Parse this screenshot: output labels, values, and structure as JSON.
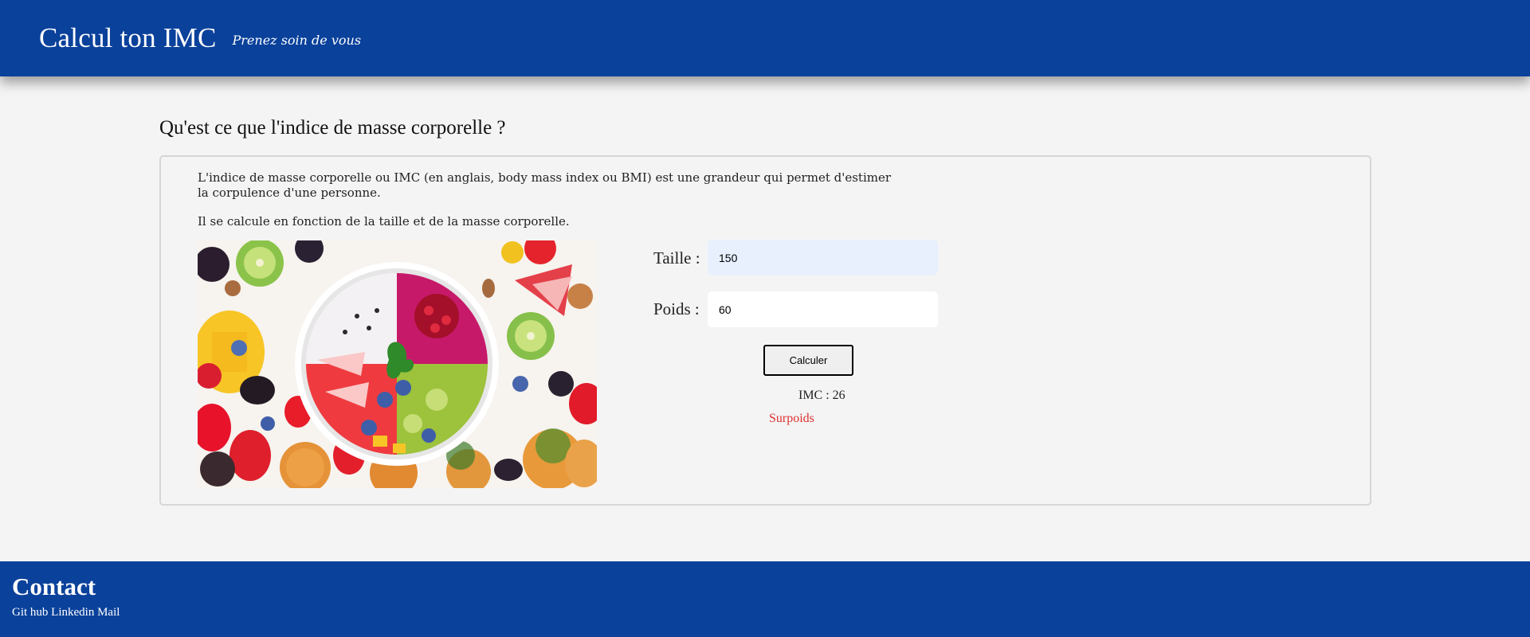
{
  "header": {
    "title": "Calcul ton IMC",
    "tagline": "Prenez soin de vous"
  },
  "main": {
    "heading": "Qu'est ce que l'indice de masse corporelle ?",
    "intro": "L'indice de masse corporelle ou IMC (en anglais, body mass index ou BMI) est une grandeur qui permet d'estimer la corpulence d'une personne.",
    "intro_2": "Il se calcule en fonction de la taille et de la masse corporelle.",
    "image_icon": "fruit-bowl-photo"
  },
  "form": {
    "height_label": "Taille :",
    "height_value": "150",
    "weight_label": "Poids :",
    "weight_value": "60",
    "calculate_label": "Calculer",
    "result_text": "IMC : 26",
    "category_text": "Surpoids"
  },
  "footer": {
    "title": "Contact",
    "links": [
      "Git hub",
      "Linkedin",
      "Mail"
    ]
  },
  "colors": {
    "brand_blue": "#0a419b",
    "height_field_bg": "#e8f0fe",
    "category_red": "#e03030",
    "page_bg": "#f4f4f4"
  }
}
